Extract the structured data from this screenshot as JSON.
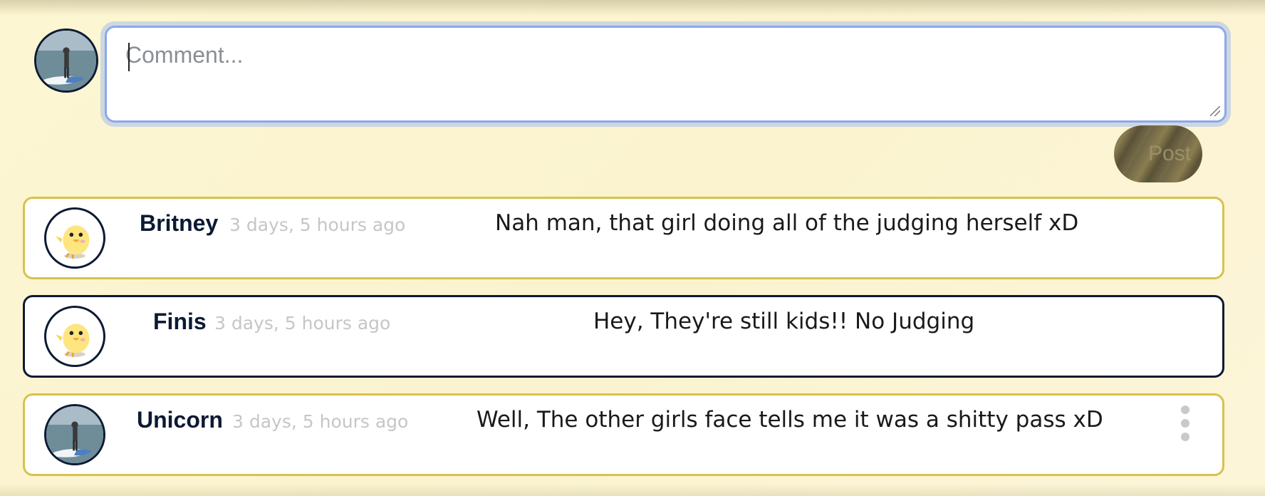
{
  "composer": {
    "placeholder": "Comment...",
    "post_label": "Post"
  },
  "comments": [
    {
      "author": "Britney",
      "time": "3 days, 5 hours ago",
      "text": "Nah man, that girl doing all of the judging herself xD",
      "avatar": "duck-avatar"
    },
    {
      "author": "Finis",
      "time": "3 days, 5 hours ago",
      "text": "Hey, They're still kids!! No Judging",
      "avatar": "duck-avatar"
    },
    {
      "author": "Unicorn",
      "time": "3 days, 5 hours ago",
      "text": "Well, The other girls face tells me it was a shitty pass xD",
      "avatar": "paddleboard-avatar"
    }
  ],
  "colors": {
    "accent_gold": "#d8c24a",
    "navy": "#0c1a33",
    "focus_blue": "#8aa9ea",
    "background": "#fdf6d2"
  }
}
